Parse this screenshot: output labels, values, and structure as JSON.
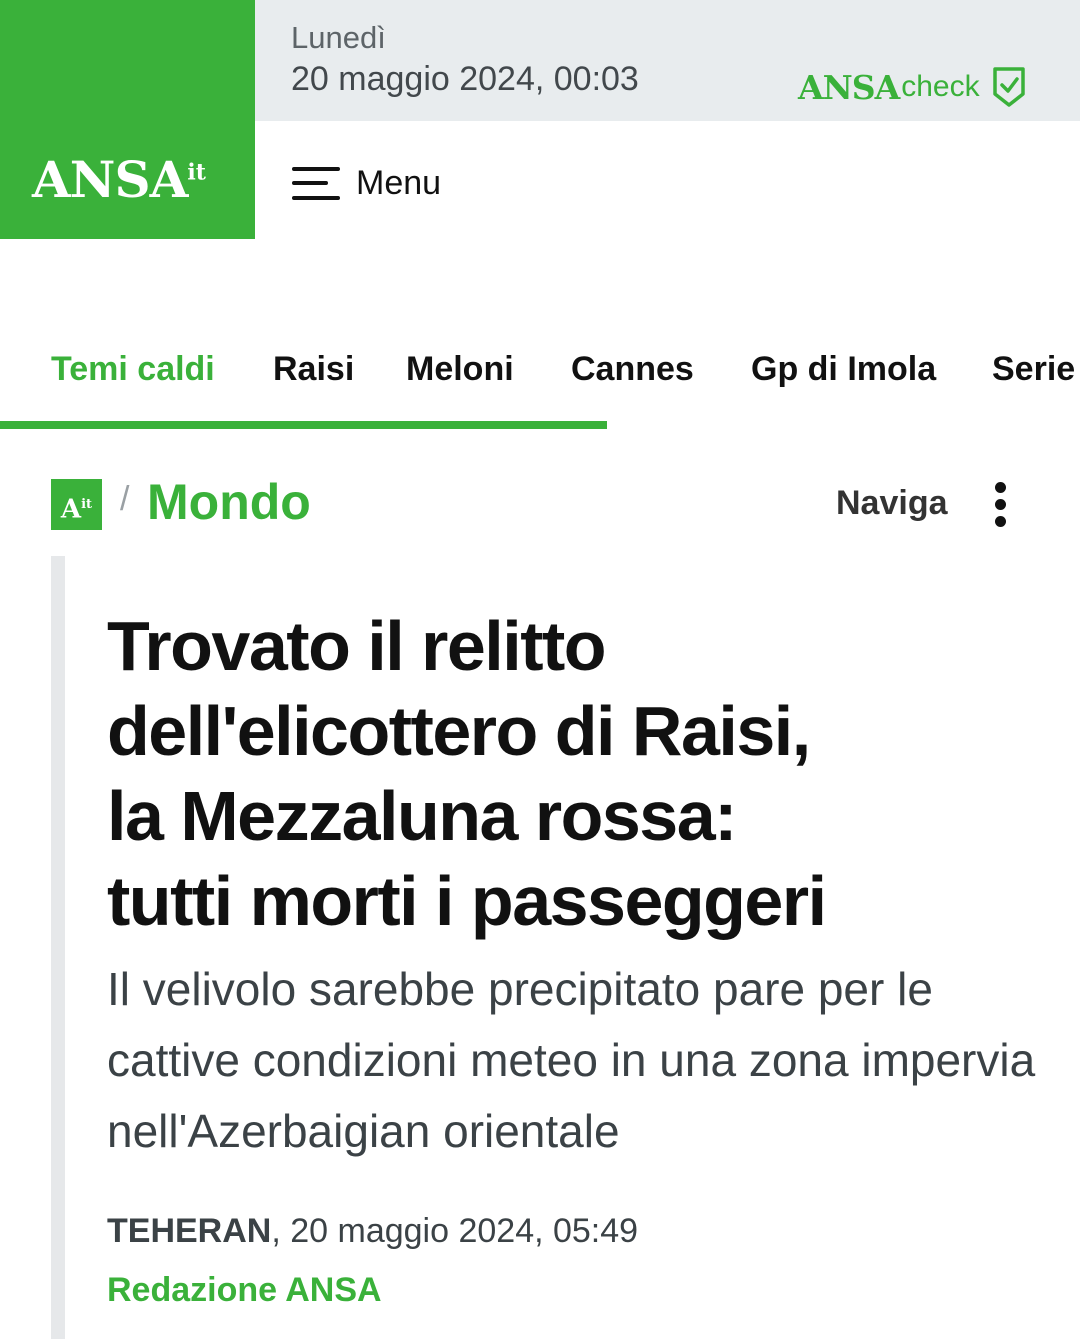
{
  "colors": {
    "brand_green": "#3ab13a",
    "date_bar_bg": "#e8ecee"
  },
  "header": {
    "logo_text": "ANSA",
    "logo_suffix": "it",
    "date_day": "Lunedì",
    "date_full": "20 maggio 2024, 00:03",
    "ansacheck_brand": "ANSA",
    "ansacheck_suffix": "check",
    "ansacheck_icon": "shield-check-icon",
    "menu_icon": "hamburger-menu-icon",
    "menu_label": "Menu"
  },
  "topics": {
    "items": [
      "Temi caldi",
      "Raisi",
      "Meloni",
      "Cannes",
      "Gp di Imola",
      "Serie"
    ],
    "active_index": 0
  },
  "section": {
    "logo_text": "A",
    "logo_suffix": "it",
    "separator": "/",
    "name": "Mondo",
    "navigate_label": "Naviga",
    "more_icon": "more-vertical-icon"
  },
  "article": {
    "headline_lines": [
      "Trovato il relitto",
      "dell'elicottero di Raisi,",
      "la Mezzaluna rossa:",
      "tutti morti i passeggeri"
    ],
    "subheadline": "Il velivolo sarebbe precipitato pare per le cattive condizioni meteo in una zona impervia nell'Azerbaigian orientale",
    "dateline_place": "TEHERAN",
    "dateline_date": ", 20 maggio 2024, 05:49",
    "author": "Redazione ANSA"
  }
}
